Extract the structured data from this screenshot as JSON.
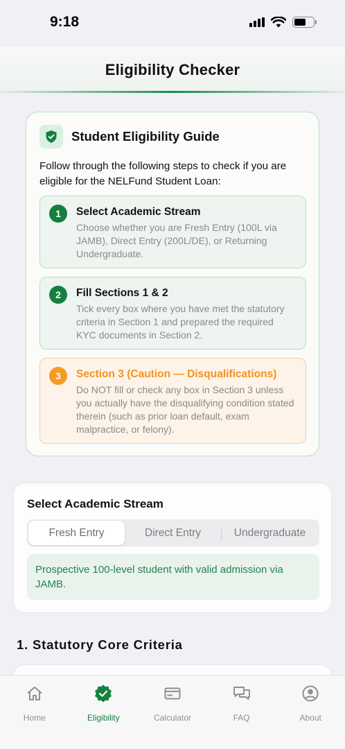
{
  "status_bar": {
    "time": "9:18"
  },
  "header": {
    "title": "Eligibility Checker"
  },
  "guide": {
    "title": "Student Eligibility Guide",
    "intro": "Follow through the following steps to check if you are eligible for the NELFund Student Loan:",
    "steps": [
      {
        "number": "1",
        "title": "Select Academic Stream",
        "description": "Choose whether you are Fresh Entry (100L via JAMB), Direct Entry (200L/DE), or Returning Undergraduate.",
        "tone": "green"
      },
      {
        "number": "2",
        "title": "Fill Sections 1 & 2",
        "description": "Tick every box where you have met the statutory criteria in Section 1 and prepared the required KYC documents in Section 2.",
        "tone": "green"
      },
      {
        "number": "3",
        "title": "Section 3 (Caution — Disqualifications)",
        "description": "Do NOT fill or check any box in Section 3 unless you actually have the disqualifying condition stated therein (such as prior loan default, exam malpractice, or felony).",
        "tone": "orange"
      }
    ]
  },
  "stream": {
    "label": "Select Academic Stream",
    "options": [
      "Fresh Entry",
      "Direct Entry",
      "Undergraduate"
    ],
    "selected": "Fresh Entry",
    "description": "Prospective 100-level student with valid admission via JAMB."
  },
  "section1": {
    "heading": "1. Statutory Core Criteria"
  },
  "tab_bar": {
    "tabs": [
      {
        "label": "Home",
        "icon": "home-icon",
        "active": false
      },
      {
        "label": "Eligibility",
        "icon": "verified-badge-icon",
        "active": true
      },
      {
        "label": "Calculator",
        "icon": "card-icon",
        "active": false
      },
      {
        "label": "FAQ",
        "icon": "chat-bubbles-icon",
        "active": false
      },
      {
        "label": "About",
        "icon": "person-circle-icon",
        "active": false
      }
    ]
  },
  "colors": {
    "brand_green": "#15803d",
    "caution_orange": "#f59a23",
    "info_green_text": "#23824f"
  }
}
